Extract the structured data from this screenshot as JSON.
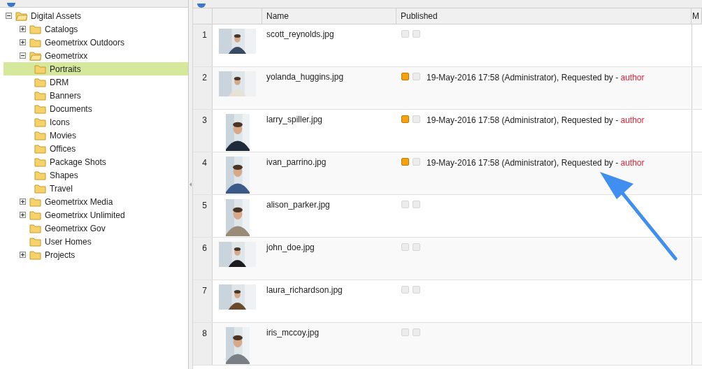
{
  "tree": [
    {
      "label": "Digital Assets",
      "expanded": true,
      "selected": false,
      "children": [
        {
          "label": "Catalogs",
          "expanded": false,
          "selected": false
        },
        {
          "label": "Geometrixx Outdoors",
          "expanded": false,
          "selected": false
        },
        {
          "label": "Geometrixx",
          "expanded": true,
          "selected": false,
          "children": [
            {
              "label": "Portraits",
              "selected": true
            },
            {
              "label": "DRM",
              "selected": false
            },
            {
              "label": "Banners",
              "selected": false
            },
            {
              "label": "Documents",
              "selected": false
            },
            {
              "label": "Icons",
              "selected": false
            },
            {
              "label": "Movies",
              "selected": false
            },
            {
              "label": "Offices",
              "selected": false
            },
            {
              "label": "Package Shots",
              "selected": false
            },
            {
              "label": "Shapes",
              "selected": false
            },
            {
              "label": "Travel",
              "selected": false
            }
          ]
        },
        {
          "label": "Geometrixx Media",
          "expanded": false,
          "selected": false
        },
        {
          "label": "Geometrixx Unlimited",
          "expanded": false,
          "selected": false
        },
        {
          "label": "Geometrixx Gov",
          "selected": false
        },
        {
          "label": "User Homes",
          "selected": false
        },
        {
          "label": "Projects",
          "expanded": false,
          "selected": false
        }
      ]
    }
  ],
  "table": {
    "columns": [
      "Name",
      "Published",
      "M"
    ],
    "rows": [
      {
        "number": "1",
        "thumbnail": {
          "kind": "wide"
        },
        "name": "scott_reynolds.jpg",
        "published": false
      },
      {
        "number": "2",
        "thumbnail": {
          "kind": "wide"
        },
        "name": "yolanda_huggins.jpg",
        "published": true,
        "published_text": "19-May-2016 17:58 (Administrator), Requested by - ",
        "requester": "author"
      },
      {
        "number": "3",
        "thumbnail": {
          "kind": "tall"
        },
        "name": "larry_spiller.jpg",
        "published": true,
        "published_text": "19-May-2016 17:58 (Administrator), Requested by - ",
        "requester": "author"
      },
      {
        "number": "4",
        "thumbnail": {
          "kind": "tall"
        },
        "name": "ivan_parrino.jpg",
        "published": true,
        "published_text": "19-May-2016 17:58 (Administrator), Requested by - ",
        "requester": "author"
      },
      {
        "number": "5",
        "thumbnail": {
          "kind": "tall"
        },
        "name": "alison_parker.jpg",
        "published": false
      },
      {
        "number": "6",
        "thumbnail": {
          "kind": "wide"
        },
        "name": "john_doe.jpg",
        "published": false
      },
      {
        "number": "7",
        "thumbnail": {
          "kind": "wide"
        },
        "name": "laura_richardson.jpg",
        "published": false
      },
      {
        "number": "8",
        "thumbnail": {
          "kind": "tall"
        },
        "name": "iris_mccoy.jpg",
        "published": false
      }
    ]
  }
}
